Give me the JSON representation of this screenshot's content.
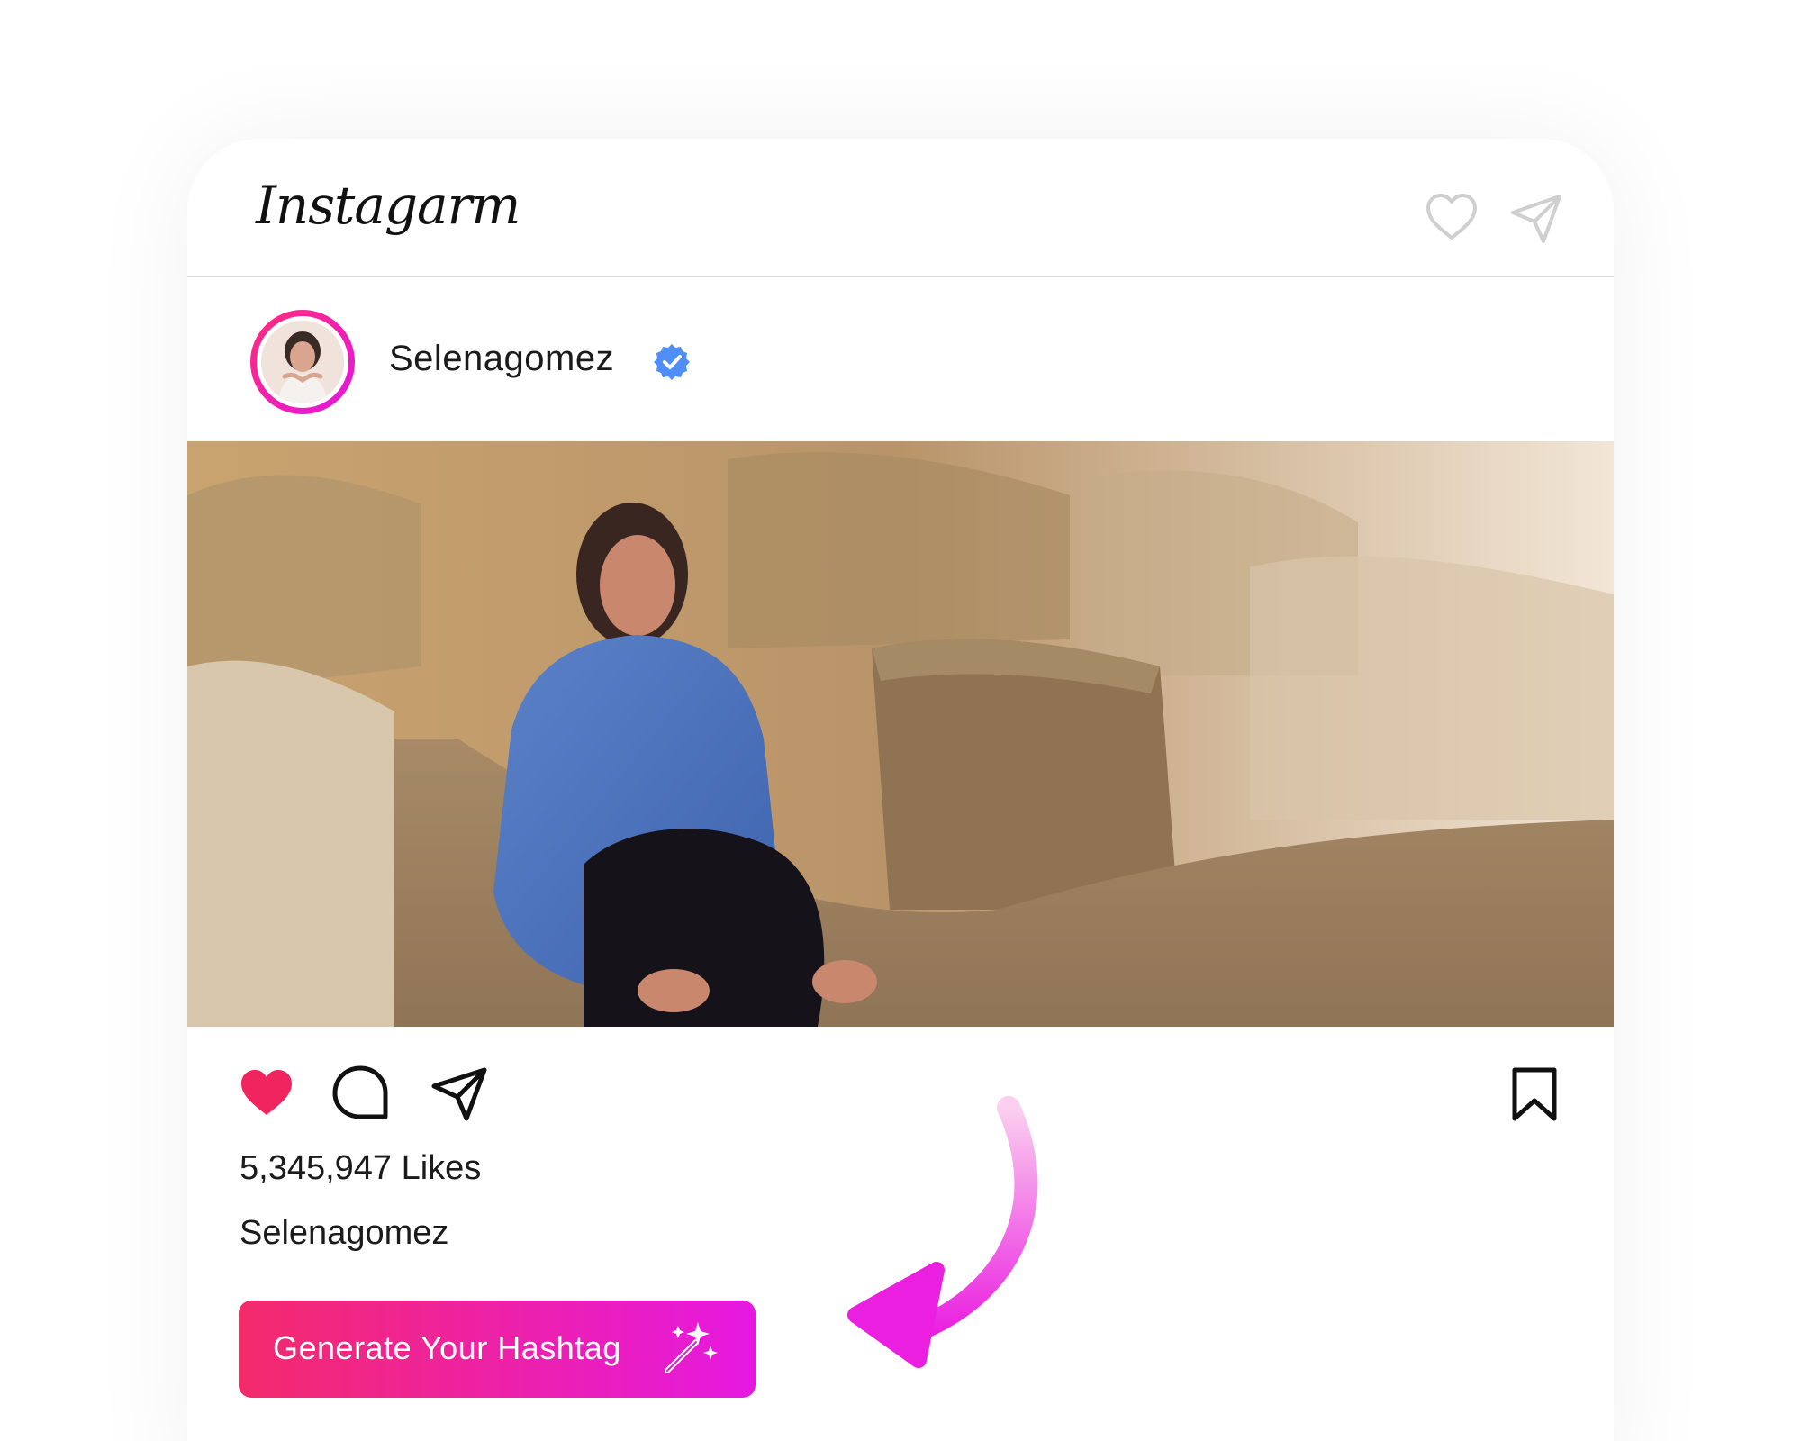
{
  "header": {
    "logo_text": "Instagarm",
    "icons": [
      "heart-icon",
      "send-icon"
    ]
  },
  "post": {
    "username": "Selenagomez",
    "verified_icon": "verified-badge-icon",
    "likes_text": "5,345,947 Likes",
    "caption_username": "Selenagomez",
    "actions": [
      "like-icon",
      "comment-icon",
      "share-icon",
      "bookmark-icon"
    ],
    "liked": true
  },
  "cta": {
    "label": "Generate Your Hashtag",
    "icon": "magic-wand-icon"
  },
  "colors": {
    "accent_pink": "#f42a6b",
    "accent_magenta": "#e619e2",
    "verified_blue": "#4f8ef7",
    "like_red": "#f0245e"
  }
}
